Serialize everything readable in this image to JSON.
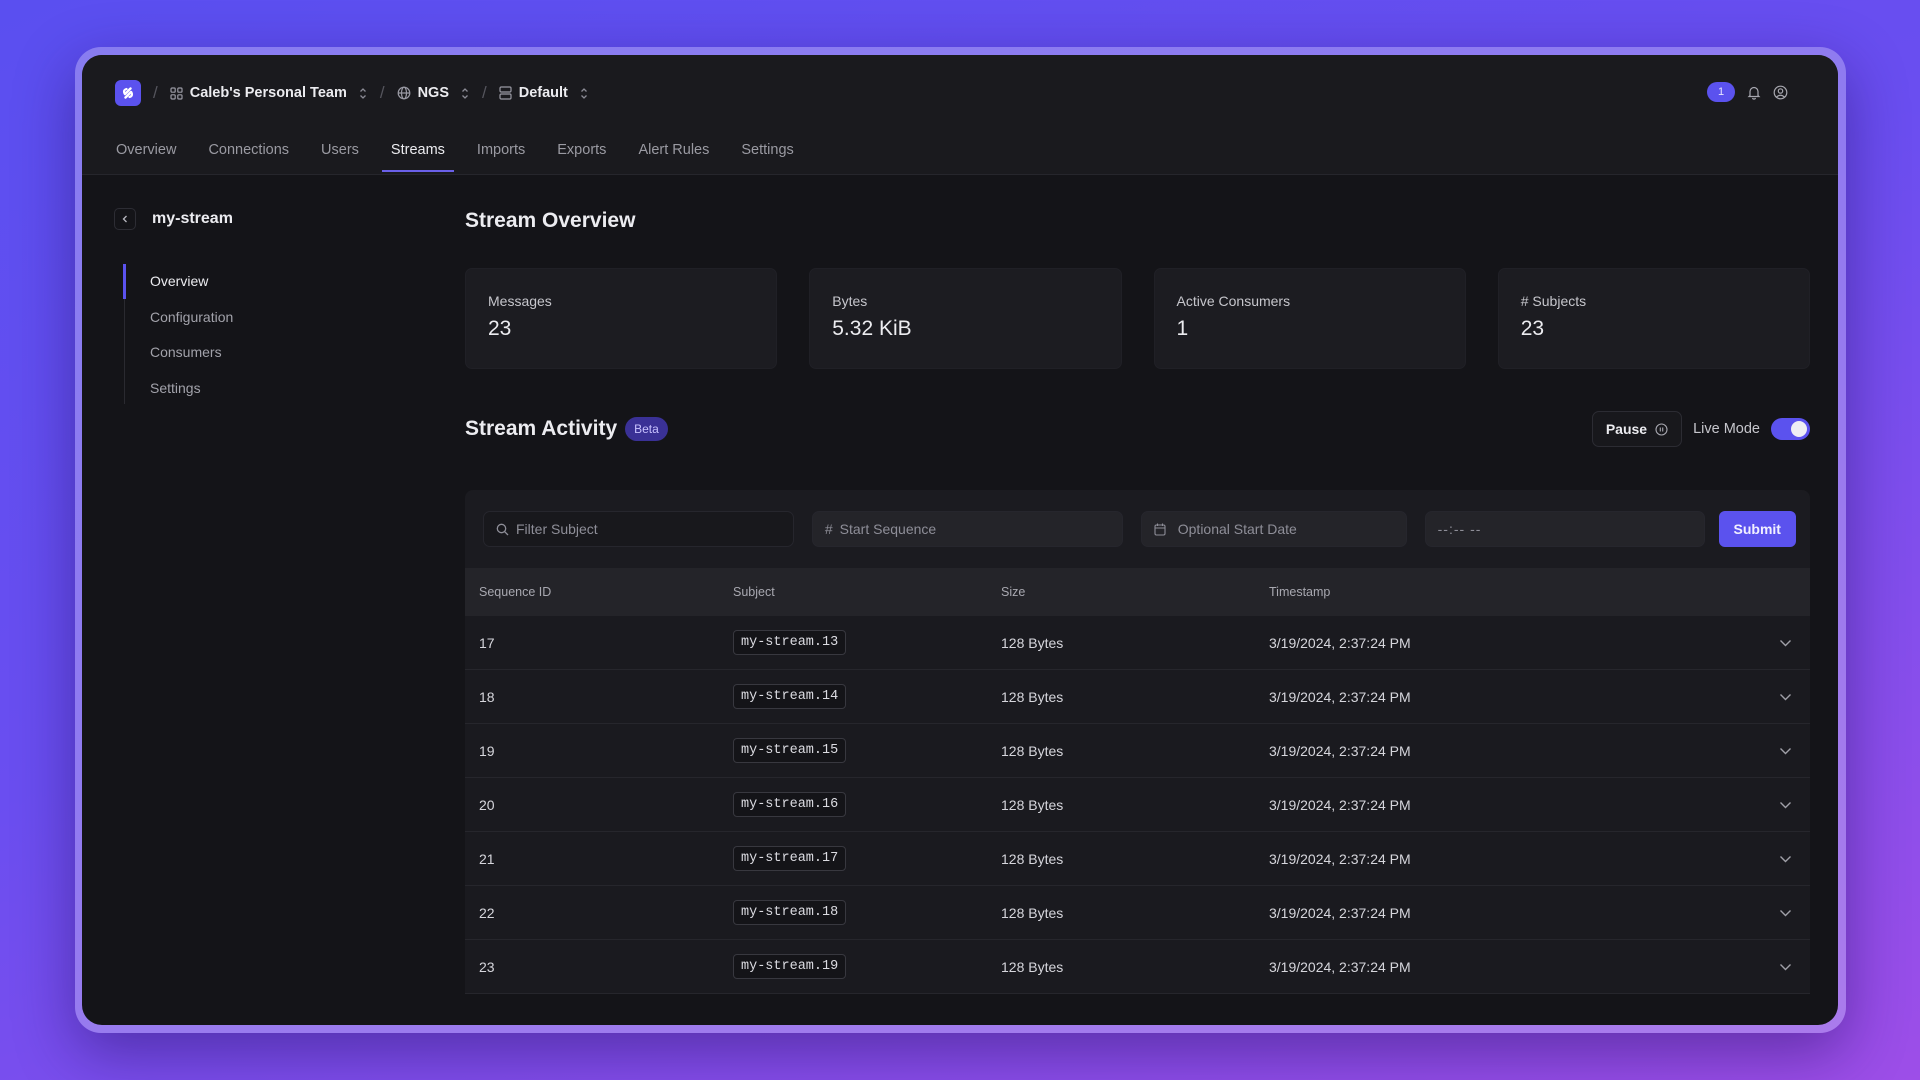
{
  "colors": {
    "accent": "#5b52ee",
    "background_panel": "#141418",
    "beta_badge_bg": "#3a3196"
  },
  "header": {
    "logo_icon": "synadia-logo-icon",
    "breadcrumbs": [
      {
        "icon": "grid-icon",
        "label": "Caleb's Personal Team"
      },
      {
        "icon": "globe-icon",
        "label": "NGS"
      },
      {
        "icon": "server-icon",
        "label": "Default"
      }
    ],
    "notification_count": "1",
    "tabs": [
      {
        "label": "Overview",
        "active": false
      },
      {
        "label": "Connections",
        "active": false
      },
      {
        "label": "Users",
        "active": false
      },
      {
        "label": "Streams",
        "active": true
      },
      {
        "label": "Imports",
        "active": false
      },
      {
        "label": "Exports",
        "active": false
      },
      {
        "label": "Alert Rules",
        "active": false
      },
      {
        "label": "Settings",
        "active": false
      }
    ]
  },
  "sidebar": {
    "stream_name": "my-stream",
    "items": [
      {
        "label": "Overview",
        "active": true
      },
      {
        "label": "Configuration",
        "active": false
      },
      {
        "label": "Consumers",
        "active": false
      },
      {
        "label": "Settings",
        "active": false
      }
    ]
  },
  "overview": {
    "title": "Stream Overview",
    "cards": [
      {
        "label": "Messages",
        "value": "23"
      },
      {
        "label": "Bytes",
        "value": "5.32 KiB"
      },
      {
        "label": "Active Consumers",
        "value": "1"
      },
      {
        "label": "# Subjects",
        "value": "23"
      }
    ]
  },
  "activity": {
    "title": "Stream Activity",
    "badge": "Beta",
    "pause_label": "Pause",
    "live_mode_label": "Live Mode",
    "live_mode_on": true,
    "filters": {
      "subject_placeholder": "Filter Subject",
      "sequence_placeholder": "Start Sequence",
      "date_placeholder": "Optional Start Date",
      "time_placeholder": "--:-- --",
      "submit_label": "Submit"
    },
    "columns": [
      "Sequence ID",
      "Subject",
      "Size",
      "Timestamp"
    ],
    "rows": [
      {
        "seq": "17",
        "subject": "my-stream.13",
        "size": "128 Bytes",
        "timestamp": "3/19/2024, 2:37:24 PM"
      },
      {
        "seq": "18",
        "subject": "my-stream.14",
        "size": "128 Bytes",
        "timestamp": "3/19/2024, 2:37:24 PM"
      },
      {
        "seq": "19",
        "subject": "my-stream.15",
        "size": "128 Bytes",
        "timestamp": "3/19/2024, 2:37:24 PM"
      },
      {
        "seq": "20",
        "subject": "my-stream.16",
        "size": "128 Bytes",
        "timestamp": "3/19/2024, 2:37:24 PM"
      },
      {
        "seq": "21",
        "subject": "my-stream.17",
        "size": "128 Bytes",
        "timestamp": "3/19/2024, 2:37:24 PM"
      },
      {
        "seq": "22",
        "subject": "my-stream.18",
        "size": "128 Bytes",
        "timestamp": "3/19/2024, 2:37:24 PM"
      },
      {
        "seq": "23",
        "subject": "my-stream.19",
        "size": "128 Bytes",
        "timestamp": "3/19/2024, 2:37:24 PM"
      }
    ]
  }
}
